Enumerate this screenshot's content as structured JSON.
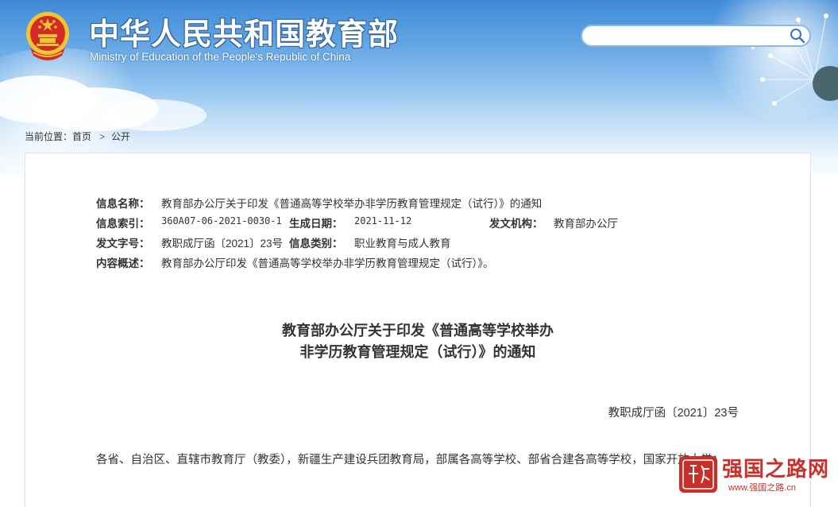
{
  "header": {
    "title": "中华人民共和国教育部",
    "subtitle": "Ministry of Education of the People's Republic of China",
    "search_placeholder": "",
    "colors": {
      "sky": "#5fa3e3",
      "emblem_red": "#d22b25",
      "emblem_gold": "#f3c431"
    }
  },
  "breadcrumb": {
    "label": "当前位置：",
    "home": "首页",
    "separator": ">",
    "current": "公开"
  },
  "meta": {
    "name_label": "信息名称：",
    "name_value": "教育部办公厅关于印发《普通高等学校举办非学历教育管理规定（试行）》的通知",
    "index_label": "信息索引：",
    "index_value": "360A07-06-2021-0030-1",
    "date_label": "生成日期：",
    "date_value": "2021-11-12",
    "issuer_label": "发文机构：",
    "issuer_value": "教育部办公厅",
    "docno_label": "发文字号：",
    "docno_value": "教职成厅函〔2021〕23号",
    "category_label": "信息类别：",
    "category_value": "职业教育与成人教育",
    "summary_label": "内容概述：",
    "summary_value": "教育部办公厅印发《普通高等学校举办非学历教育管理规定（试行）》。"
  },
  "document": {
    "title_line1": "教育部办公厅关于印发《普通高等学校举办",
    "title_line2": "非学历教育管理规定（试行）》的通知",
    "number": "教职成厅函〔2021〕23号",
    "salutation": "各省、自治区、直辖市教育厅（教委），新疆生产建设兵团教育局，部属各高等学校、部省合建各高等学校，国家开放大学："
  },
  "watermark": {
    "text": "强国之路网",
    "url": "www.强国之路.cn",
    "color": "#c8312b"
  }
}
